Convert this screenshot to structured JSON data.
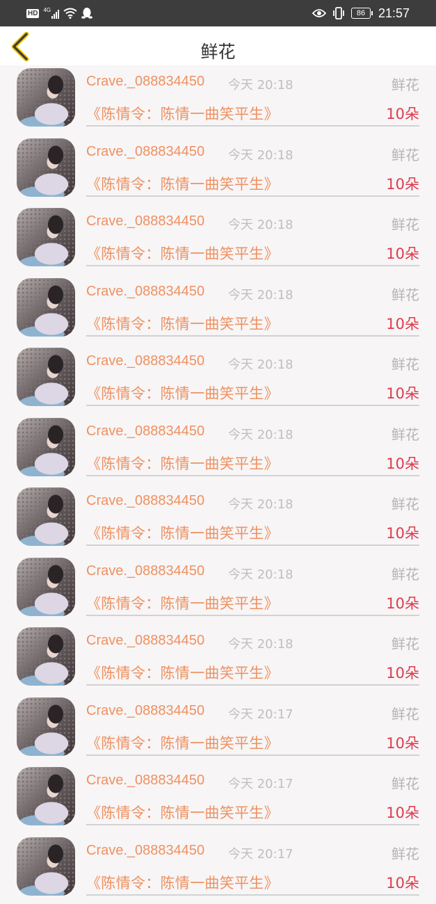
{
  "status_bar": {
    "hd": "HD",
    "network": "4G",
    "battery": "86",
    "time": "21:57"
  },
  "header": {
    "title": "鲜花",
    "back_icon": "chevron-left-icon",
    "back_color": "#f1c400"
  },
  "colors": {
    "accent_orange": "#ee9161",
    "count_red": "#dd3a4d",
    "muted_gray": "#b5b5b5"
  },
  "items": [
    {
      "user": "Crave._088834450",
      "time": "今天 20:18",
      "type": "鲜花",
      "work": "《陈情令：陈情一曲笑平生》",
      "count": "10朵"
    },
    {
      "user": "Crave._088834450",
      "time": "今天 20:18",
      "type": "鲜花",
      "work": "《陈情令：陈情一曲笑平生》",
      "count": "10朵"
    },
    {
      "user": "Crave._088834450",
      "time": "今天 20:18",
      "type": "鲜花",
      "work": "《陈情令：陈情一曲笑平生》",
      "count": "10朵"
    },
    {
      "user": "Crave._088834450",
      "time": "今天 20:18",
      "type": "鲜花",
      "work": "《陈情令：陈情一曲笑平生》",
      "count": "10朵"
    },
    {
      "user": "Crave._088834450",
      "time": "今天 20:18",
      "type": "鲜花",
      "work": "《陈情令：陈情一曲笑平生》",
      "count": "10朵"
    },
    {
      "user": "Crave._088834450",
      "time": "今天 20:18",
      "type": "鲜花",
      "work": "《陈情令：陈情一曲笑平生》",
      "count": "10朵"
    },
    {
      "user": "Crave._088834450",
      "time": "今天 20:18",
      "type": "鲜花",
      "work": "《陈情令：陈情一曲笑平生》",
      "count": "10朵"
    },
    {
      "user": "Crave._088834450",
      "time": "今天 20:18",
      "type": "鲜花",
      "work": "《陈情令：陈情一曲笑平生》",
      "count": "10朵"
    },
    {
      "user": "Crave._088834450",
      "time": "今天 20:18",
      "type": "鲜花",
      "work": "《陈情令：陈情一曲笑平生》",
      "count": "10朵"
    },
    {
      "user": "Crave._088834450",
      "time": "今天 20:17",
      "type": "鲜花",
      "work": "《陈情令：陈情一曲笑平生》",
      "count": "10朵"
    },
    {
      "user": "Crave._088834450",
      "time": "今天 20:17",
      "type": "鲜花",
      "work": "《陈情令：陈情一曲笑平生》",
      "count": "10朵"
    },
    {
      "user": "Crave._088834450",
      "time": "今天 20:17",
      "type": "鲜花",
      "work": "《陈情令：陈情一曲笑平生》",
      "count": "10朵"
    }
  ]
}
